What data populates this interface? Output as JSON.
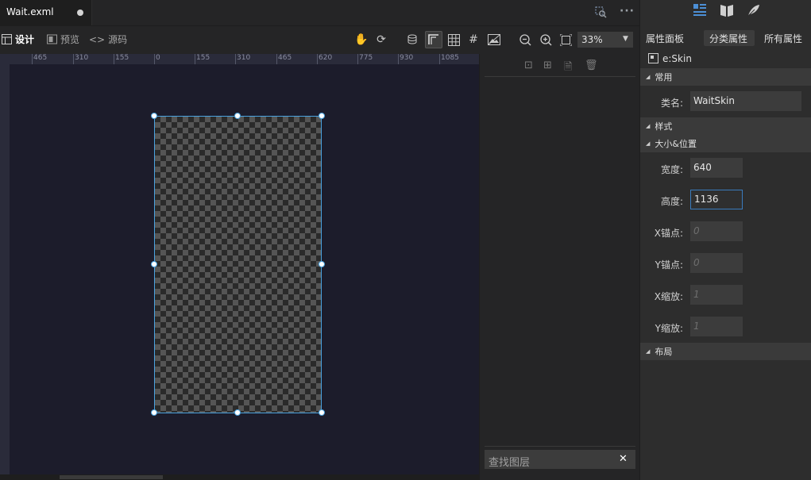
{
  "tab": {
    "title": "Wait.exml"
  },
  "toolbar": {
    "design_label": "设计",
    "preview_label": "预览",
    "source_label": "源码",
    "zoom_value": "33%"
  },
  "ruler": {
    "top_labels": [
      "465",
      "310",
      "155",
      "0",
      "155",
      "310",
      "465",
      "620",
      "775",
      "930",
      "1085"
    ]
  },
  "layers": {
    "search_placeholder": "查找图层"
  },
  "props": {
    "tabs": [
      "属性面板",
      "分类属性",
      "所有属性"
    ],
    "skin_label": "e:Skin",
    "sections": {
      "common": "常用",
      "style": "样式",
      "size_pos": "大小&位置",
      "layout": "布局"
    },
    "fields": {
      "class_label": "类名:",
      "class_value": "WaitSkin",
      "width_label": "宽度:",
      "width_value": "640",
      "height_label": "高度:",
      "height_value": "1136",
      "anchorx_label": "X锚点:",
      "anchorx_ph": "0",
      "anchory_label": "Y锚点:",
      "anchory_ph": "0",
      "scalex_label": "X缩放:",
      "scalex_ph": "1",
      "scaley_label": "Y缩放:",
      "scaley_ph": "1"
    }
  },
  "colors": {
    "accent": "#4aa3e0",
    "canvas": "#1c1c2b",
    "panel": "#2d2d2d"
  }
}
